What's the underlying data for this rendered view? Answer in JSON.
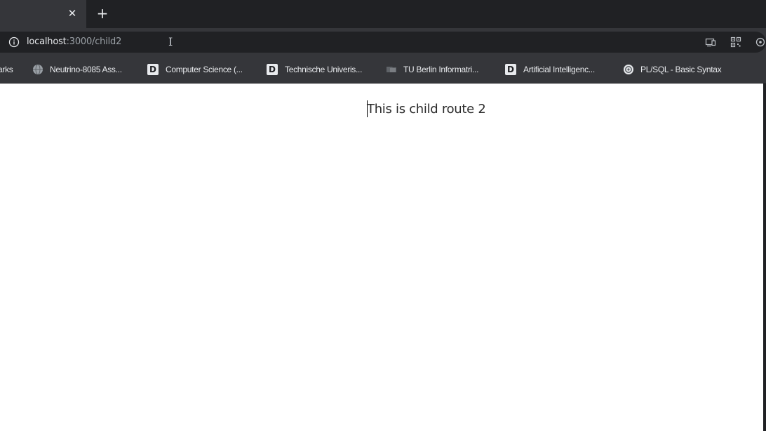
{
  "browser": {
    "tab": {
      "close_icon": "close-icon",
      "close_glyph": "✕"
    },
    "new_tab_glyph": "+",
    "address_bar": {
      "host": "localhost",
      "path": ":3000/child2",
      "info_icon": "info-icon"
    },
    "toolbar_icons": [
      "cast-icon",
      "qr-code-icon",
      "lens-icon"
    ],
    "bookmarks": [
      {
        "label": "arks",
        "icon": "none"
      },
      {
        "label": "Neutrino-8085 Ass...",
        "icon": "globe-icon"
      },
      {
        "label": "Computer Science (...",
        "icon": "d-icon"
      },
      {
        "label": "Technische Univeris...",
        "icon": "d-icon"
      },
      {
        "label": "TU Berlin Informatri...",
        "icon": "folder-tab-icon"
      },
      {
        "label": "Artificial Intelligenc...",
        "icon": "d-icon"
      },
      {
        "label": "PL/SQL - Basic Syntax",
        "icon": "gear-logo-icon"
      }
    ],
    "d_glyph": "D"
  },
  "page": {
    "text": "This is child route 2"
  },
  "colors": {
    "tabstrip": "#202124",
    "toolbar": "#35363a",
    "omnibox": "#202124",
    "page_bg": "#ffffff"
  }
}
